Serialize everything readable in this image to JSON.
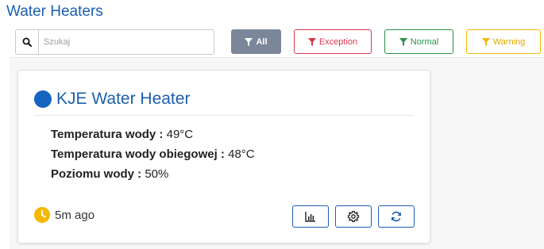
{
  "page": {
    "title": "Water Heaters"
  },
  "search": {
    "placeholder": "Szukaj",
    "value": ""
  },
  "filters": [
    {
      "label": "All",
      "color": "#7b8699",
      "active": true
    },
    {
      "label": "Exception",
      "color": "#d9364f",
      "active": false
    },
    {
      "label": "Normal",
      "color": "#2a9247",
      "active": false
    },
    {
      "label": "Warning",
      "color": "#f2b705",
      "active": false
    }
  ],
  "card": {
    "title": "KJE Water Heater",
    "status_color": "#1565c0",
    "properties": [
      {
        "name": "Temperatura wody",
        "separator": " : ",
        "value": "49°C"
      },
      {
        "name": "Temperatura wody obiegowej",
        "separator": " : ",
        "value": "48°C"
      },
      {
        "name": "Poziomu wody",
        "separator": " : ",
        "value": "50%"
      }
    ],
    "last_update": "5m ago",
    "actions": [
      {
        "icon": "bar-chart-icon"
      },
      {
        "icon": "gear-icon"
      },
      {
        "icon": "refresh-icon"
      }
    ]
  }
}
